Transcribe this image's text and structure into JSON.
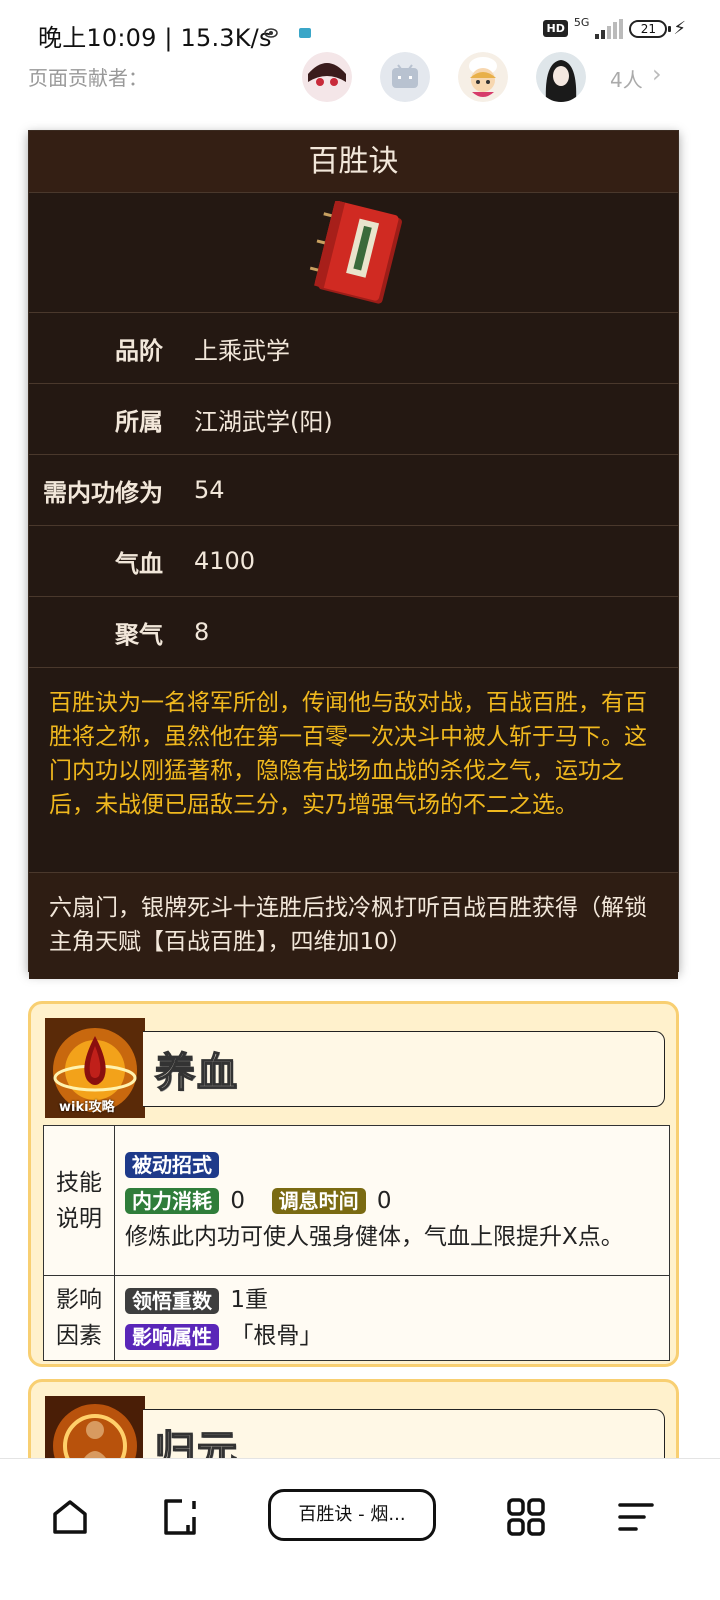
{
  "status": {
    "time": "晚上10:09 | 15.3K/s",
    "hd": "HD",
    "network": "5G",
    "battery": "21"
  },
  "contributors": {
    "label": "页面贡献者：",
    "count": "4人"
  },
  "infobox": {
    "title": "百胜诀",
    "rows": [
      {
        "key": "品阶",
        "value": "上乘武学"
      },
      {
        "key": "所属",
        "value": "江湖武学(阳)"
      },
      {
        "key": "需内功修为",
        "value": "54"
      },
      {
        "key": "气血",
        "value": "4100"
      },
      {
        "key": "聚气",
        "value": "8"
      }
    ],
    "description": "百胜诀为一名将军所创，传闻他与敌对战，百战百胜，有百胜将之称，虽然他在第一百零一次决斗中被人斩于马下。这门内功以刚猛著称，隐隐有战场血战的杀伐之气，运功之后，未战便已屈敌三分，实乃增强气场的不二之选。",
    "source": "六扇门，银牌死斗十连胜后找冷枫打听百战百胜获得（解锁主角天赋【百战百胜】，四维加10）"
  },
  "skills": [
    {
      "name": "养血",
      "icon_watermark": "wiki攻略",
      "row1_label": "技能说明",
      "tag_type": "被动招式",
      "tag_cost": "内力消耗",
      "cost_value": "0",
      "tag_cooldown": "调息时间",
      "cooldown_value": "0",
      "desc": "修炼此内功可使人强身健体，气血上限提升X点。",
      "row2_label": "影响因素",
      "tag_levels": "领悟重数",
      "levels_value": "1重",
      "tag_attr": "影响属性",
      "attr_value": "「根骨」"
    },
    {
      "name": "归元"
    }
  ],
  "bottom_nav": {
    "tab_label": "百胜诀 - 烟..."
  },
  "colors": {
    "infobox_bg": "#241812",
    "desc_text": "#f0b81e",
    "card_bg": "#fff1cc",
    "card_border": "#f8cf72"
  }
}
